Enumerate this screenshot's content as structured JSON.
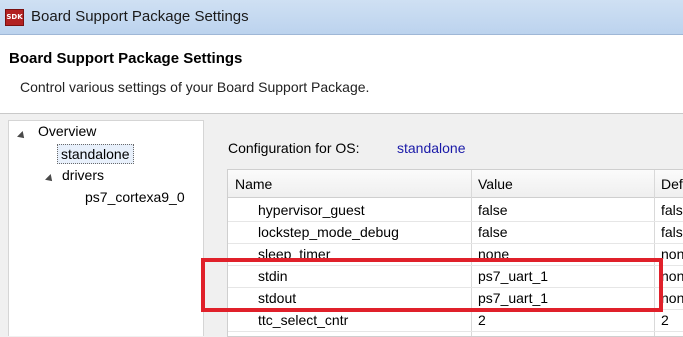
{
  "window": {
    "icon_text": "SDK",
    "title": "Board Support Package Settings"
  },
  "header": {
    "title": "Board Support Package Settings",
    "description": "Control various settings of your Board Support Package."
  },
  "tree": {
    "items": [
      {
        "label": "Overview"
      },
      {
        "label": "standalone"
      },
      {
        "label": "drivers"
      },
      {
        "label": "ps7_cortexa9_0"
      }
    ]
  },
  "config": {
    "label": "Configuration for OS:",
    "os": "standalone"
  },
  "table": {
    "columns": [
      "Name",
      "Value",
      "Def"
    ],
    "rows": [
      {
        "name": "hypervisor_guest",
        "value": "false",
        "default": "fals"
      },
      {
        "name": "lockstep_mode_debug",
        "value": "false",
        "default": "fals"
      },
      {
        "name": "sleep_timer",
        "value": "none",
        "default": "non"
      },
      {
        "name": "stdin",
        "value": "ps7_uart_1",
        "default": "non"
      },
      {
        "name": "stdout",
        "value": "ps7_uart_1",
        "default": "non"
      },
      {
        "name": "ttc_select_cntr",
        "value": "2",
        "default": "2"
      }
    ]
  },
  "colors": {
    "highlight": "#e0202a",
    "link": "#1a1aa8"
  }
}
